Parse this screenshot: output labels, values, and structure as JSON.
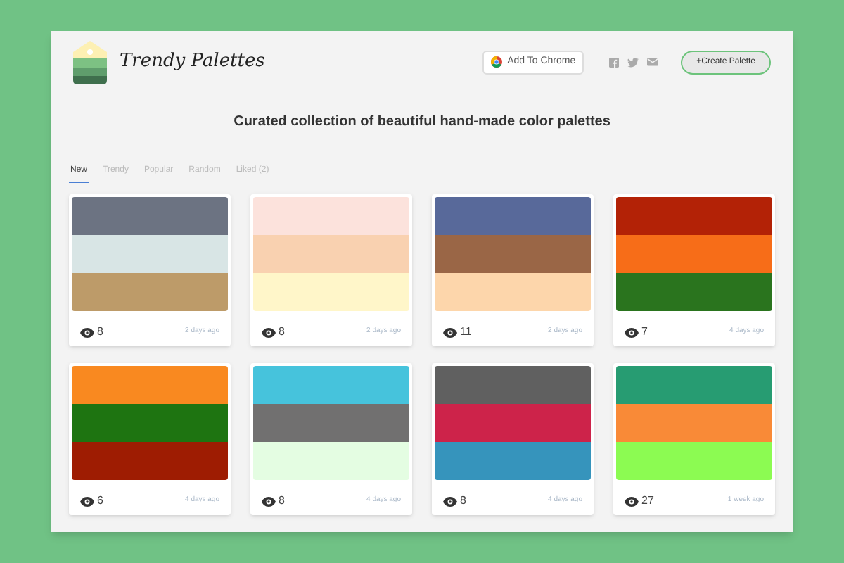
{
  "header": {
    "brand": "Trendy Palettes",
    "chrome_button": "Add To Chrome",
    "create_button": "+Create Palette"
  },
  "tagline": "Curated collection of beautiful hand-made color palettes",
  "tabs": [
    {
      "label": "New",
      "selected": true
    },
    {
      "label": "Trendy",
      "selected": false
    },
    {
      "label": "Popular",
      "selected": false
    },
    {
      "label": "Random",
      "selected": false
    },
    {
      "label": "Liked (2)",
      "selected": false
    }
  ],
  "palettes": [
    {
      "swatches": [
        {
          "color": "#6c7382"
        },
        {
          "color": "#d8e5e5"
        },
        {
          "color": "#bd9b69"
        }
      ],
      "views": "8",
      "date": "2 days ago"
    },
    {
      "swatches": [
        {
          "color": "#fce2dc"
        },
        {
          "color": "#f9d1b0"
        },
        {
          "color": "#fff6c9"
        }
      ],
      "views": "8",
      "date": "2 days ago"
    },
    {
      "swatches": [
        {
          "color": "#58699a"
        },
        {
          "color": "#9a6646"
        },
        {
          "color": "#fdd6ab"
        }
      ],
      "views": "11",
      "date": "2 days ago"
    },
    {
      "swatches": [
        {
          "color": "#b32206"
        },
        {
          "color": "#f76d18"
        },
        {
          "color": "#2a741e"
        }
      ],
      "views": "7",
      "date": "4 days ago"
    },
    {
      "swatches": [
        {
          "color": "#f98920"
        },
        {
          "color": "#1e7411"
        },
        {
          "color": "#9e1c02"
        }
      ],
      "views": "6",
      "date": "4 days ago"
    },
    {
      "swatches": [
        {
          "color": "#46c3dc"
        },
        {
          "color": "#717070"
        },
        {
          "color": "#e4fde2"
        }
      ],
      "views": "8",
      "date": "4 days ago"
    },
    {
      "swatches": [
        {
          "color": "#606060"
        },
        {
          "color": "#cd234a"
        },
        {
          "color": "#3694bc"
        }
      ],
      "views": "8",
      "date": "4 days ago"
    },
    {
      "swatches": [
        {
          "color": "#279c72"
        },
        {
          "color": "#f98a37"
        },
        {
          "color": "#8cfb52"
        }
      ],
      "views": "27",
      "date": "1 week ago"
    }
  ]
}
